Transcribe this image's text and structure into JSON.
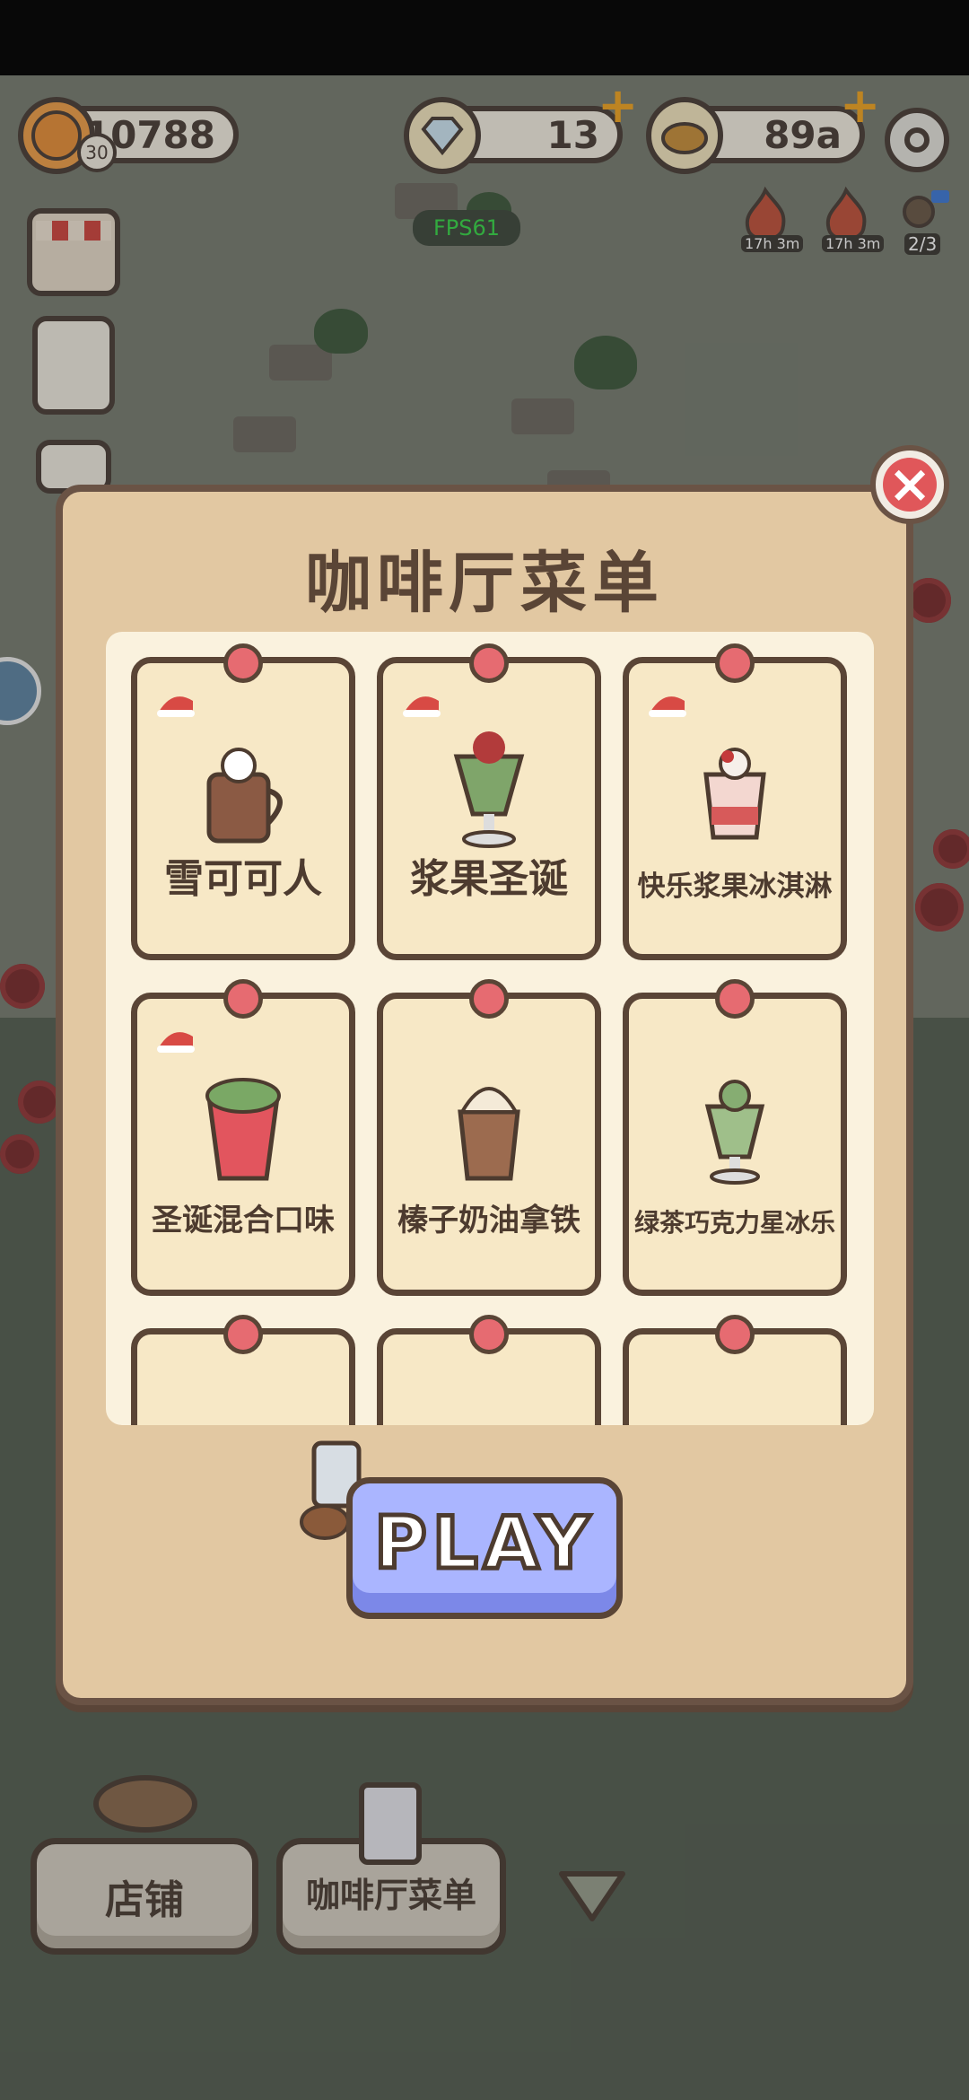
{
  "hud": {
    "coins": "10788",
    "level": "30",
    "gems": "13",
    "cookies": "89a",
    "fps": "FPS61",
    "timers": [
      "17h 3m",
      "17h 3m"
    ],
    "visitor_count": "2/3"
  },
  "modal": {
    "title": "咖啡厅菜单",
    "items": [
      {
        "name": "雪可可人",
        "seasonal": true
      },
      {
        "name": "浆果圣诞",
        "seasonal": true
      },
      {
        "name": "快乐浆果冰淇淋",
        "seasonal": true
      },
      {
        "name": "圣诞混合口味",
        "seasonal": true
      },
      {
        "name": "榛子奶油拿铁",
        "seasonal": false
      },
      {
        "name": "绿茶巧克力星冰乐",
        "seasonal": false
      }
    ],
    "play_label": "PLAY"
  },
  "bottom_bar": {
    "shop_label": "店铺",
    "menu_label": "咖啡厅菜单"
  }
}
